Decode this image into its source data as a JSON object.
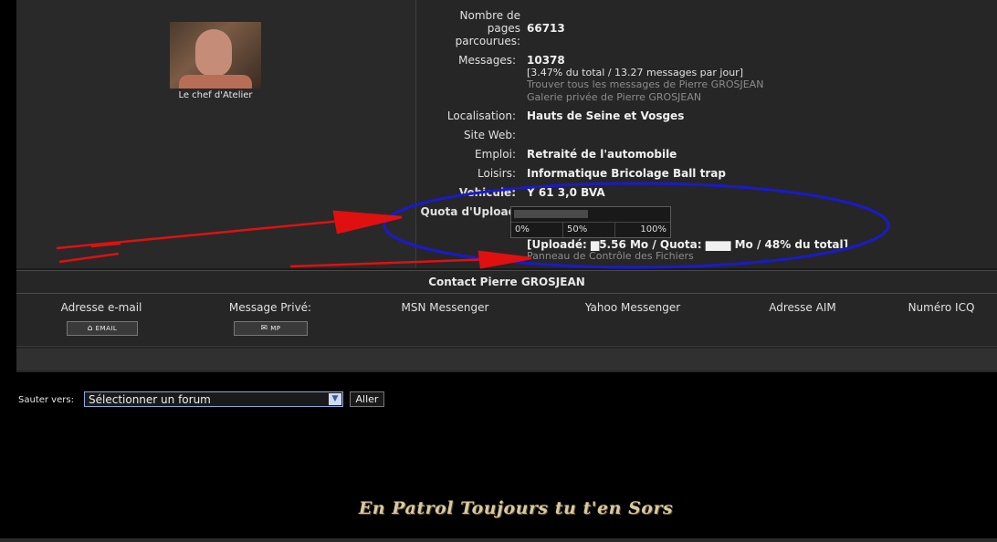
{
  "profile": {
    "avatar_caption": "Le chef d'Atelier",
    "fields": [
      {
        "label_lines": [
          "Nombre de",
          "pages",
          "parcourues:"
        ],
        "value": "66713"
      },
      {
        "label_lines": [
          "Messages:"
        ],
        "value": "10378"
      },
      {
        "label_lines": [
          "Localisation:"
        ],
        "value": "Hauts de Seine et Vosges"
      },
      {
        "label_lines": [
          "Site Web:"
        ],
        "value": ""
      },
      {
        "label_lines": [
          "Emploi:"
        ],
        "value": "Retraité de l'automobile"
      },
      {
        "label_lines": [
          "Loisirs:"
        ],
        "value": "Informatique Bricolage Ball trap"
      },
      {
        "label_lines": [
          "Vehicule:"
        ],
        "value": "Y 61 3,0 BVA"
      },
      {
        "label_lines": [
          "Quota d'Upload:"
        ],
        "value": ""
      }
    ],
    "messages_stats": "[3.47% du total / 13.27 messages par jour]",
    "messages_links": [
      "Trouver tous les messages de Pierre GROSJEAN",
      "Galerie privée de Pierre GROSJEAN"
    ],
    "quota": {
      "fill_fraction": 0.48,
      "scale": [
        "0%",
        "50%",
        "100%"
      ],
      "summary": "[Uploadé: ▆5.56 Mo / Quota: ▆▆▆ Mo / 48% du total]",
      "panel_link": "Panneau de Contrôle des Fichiers"
    }
  },
  "contact": {
    "title": "Contact Pierre GROSJEAN",
    "columns": [
      {
        "label": "Adresse e-mail",
        "button": "EMAIL"
      },
      {
        "label": "Message Privé:",
        "button": "MP"
      },
      {
        "label": "MSN Messenger",
        "button": ""
      },
      {
        "label": "Yahoo Messenger",
        "button": ""
      },
      {
        "label": "Adresse AIM",
        "button": ""
      },
      {
        "label": "Numéro ICQ",
        "button": ""
      }
    ]
  },
  "jump": {
    "label": "Sauter vers:",
    "selected": "Sélectionner un forum",
    "button": "Aller"
  },
  "motto": "En Patrol Toujours tu t'en Sors",
  "colors": {
    "annotation_red": "#e01010",
    "annotation_blue": "#1a1acc"
  }
}
